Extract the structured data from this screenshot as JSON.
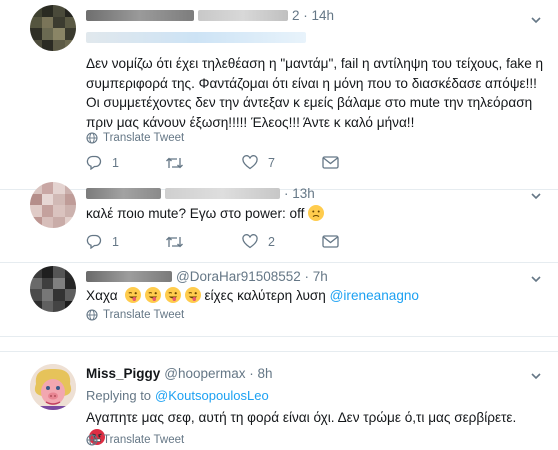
{
  "tweets": [
    {
      "time": "2 · 14h",
      "text": "Δεν νομίζω ότι έχει τηλεθέαση η \"μαντάμ\", fail η αντίληψη του τείχους, fake η συμπεριφορά της. Φαντάζομαι ότι είναι η μόνη που το διασκέδασε απόψε!!! Οι συμμετέχοντες δεν την άντεξαν κ εμείς βάλαμε στο mute την τηλεόραση πριν μας κάνουν έξωση!!!!! Έλεος!!! Άντε κ καλό μήνα!!",
      "translate": "Translate Tweet",
      "replies": "1",
      "retweets": "",
      "likes": "7"
    },
    {
      "time": "· 13h",
      "text": "καλέ ποιο mute? Εγω στο power: off",
      "replies": "1",
      "retweets": "",
      "likes": "2"
    },
    {
      "handle": "@DoraHar91508552 · 7h",
      "text_pre": "Χαχα",
      "text_mid": " είχες καλύτερη λυση ",
      "mention": "@ireneanagno",
      "translate": "Translate Tweet"
    },
    {
      "name": "Miss_Piggy",
      "handle": "@hoopermax · 8h",
      "replying_label": "Replying to",
      "replying_to": "@KoutsopoulosLeo",
      "text": "Αγαπητε μας σεφ, αυτή τη φορά είναι όχι. Δεν τρώμε ό,τι μας σερβίρετε.",
      "translate": "Translate Tweet"
    }
  ],
  "icons": {
    "reply": "reply-icon",
    "retweet": "retweet-icon",
    "like": "heart-icon",
    "dm": "envelope-icon",
    "translate": "globe-icon",
    "more": "chevron-down-icon"
  },
  "colors": {
    "link": "#1da1f2",
    "gray": "#657786",
    "divider": "#e6ecf0",
    "emoji": "#ffcc4d",
    "angry_emoji": "#dd2e44"
  }
}
